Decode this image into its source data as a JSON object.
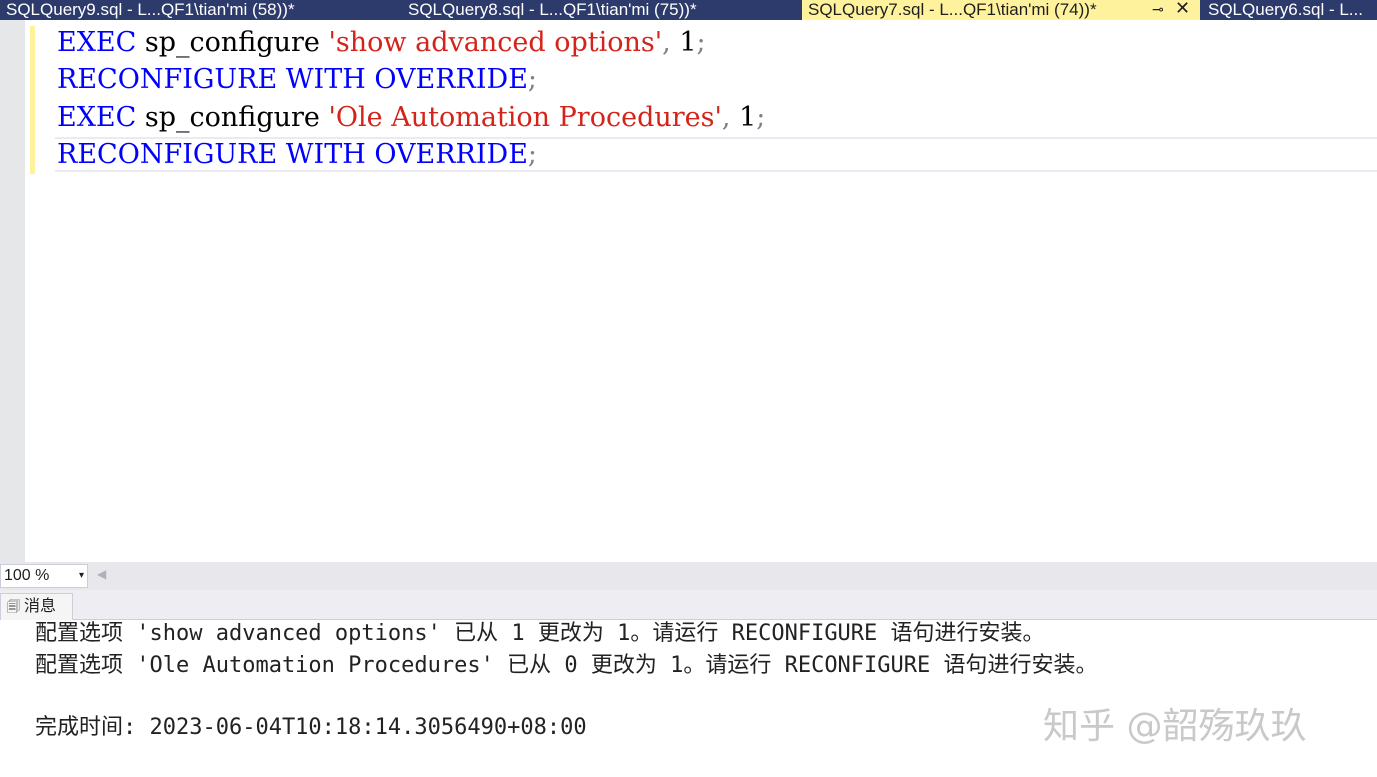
{
  "tabs": [
    {
      "label": "SQLQuery9.sql - L...QF1\\tian'mi (58))*",
      "active": false
    },
    {
      "label": "SQLQuery8.sql - L...QF1\\tian'mi (75))*",
      "active": false
    },
    {
      "label": "SQLQuery7.sql - L...QF1\\tian'mi (74))*",
      "active": true
    },
    {
      "label": "SQLQuery6.sql - L...",
      "active": false
    }
  ],
  "tab_pin_icon": "⊸",
  "tab_close_icon": "✕",
  "editor": {
    "lines": [
      {
        "kw1": "EXEC",
        "ident": "sp_configure",
        "str": "'show advanced options'",
        "comma": ",",
        "num": "1",
        "semi": ";"
      },
      {
        "kw": "RECONFIGURE WITH OVERRIDE",
        "semi": ";"
      },
      {
        "kw1": "EXEC",
        "ident": "sp_configure",
        "str": "'Ole Automation Procedures'",
        "comma": ",",
        "num": "1",
        "semi": ";"
      },
      {
        "kw": "RECONFIGURE WITH OVERRIDE",
        "semi": ";"
      }
    ]
  },
  "zoom": {
    "value": "100 %",
    "dropdown_icon": "▾",
    "scroll_left_icon": "◀"
  },
  "messages_tab": {
    "label": "消息",
    "icon": "🗐"
  },
  "messages": [
    "配置选项 'show advanced options' 已从 1 更改为 1。请运行 RECONFIGURE 语句进行安装。",
    "配置选项 'Ole Automation Procedures' 已从 0 更改为 1。请运行 RECONFIGURE 语句进行安装。",
    "完成时间: 2023-06-04T10:18:14.3056490+08:00"
  ],
  "watermark": "知乎 @韶殇玖玖",
  "colors": {
    "tab_strip": "#2d3b6c",
    "active_tab": "#fff29d",
    "keyword": "#0000ff",
    "string": "#d4231a",
    "punctuation": "#808080"
  }
}
